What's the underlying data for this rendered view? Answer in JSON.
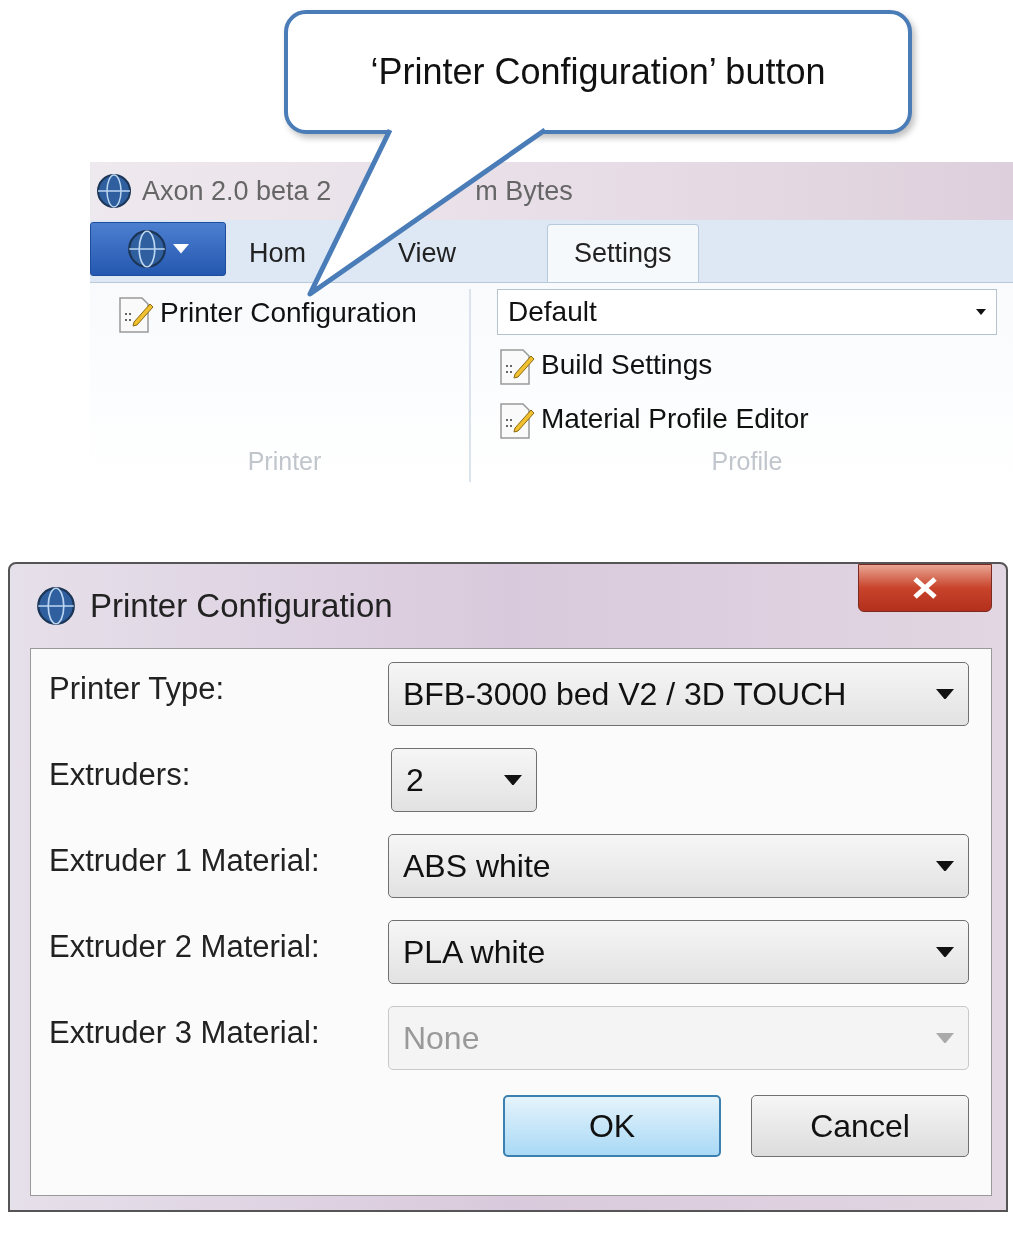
{
  "callout": {
    "text": "‘Printer Configuration’ button"
  },
  "app_window": {
    "title_parts": [
      "Axon 2.0 beta 2",
      "m Bytes"
    ],
    "tabs": [
      {
        "label": "Hom",
        "selected": false
      },
      {
        "label": "View",
        "selected": false
      },
      {
        "label": "Settings",
        "selected": true
      }
    ],
    "groups": [
      {
        "label": "Printer",
        "items": [
          {
            "kind": "button",
            "label": "Printer Configuration"
          }
        ]
      },
      {
        "label": "Profile",
        "items": [
          {
            "kind": "dropdown",
            "value": "Default"
          },
          {
            "kind": "button",
            "label": "Build Settings"
          },
          {
            "kind": "button",
            "label": "Material Profile Editor"
          }
        ]
      }
    ]
  },
  "dialog": {
    "title": "Printer Configuration",
    "fields": [
      {
        "label": "Printer Type:",
        "value": "BFB-3000 bed V2 / 3D TOUCH",
        "kind": "wide",
        "disabled": false
      },
      {
        "label": "Extruders:",
        "value": "2",
        "kind": "narrow",
        "disabled": false
      },
      {
        "label": "Extruder 1 Material:",
        "value": "ABS white",
        "kind": "wide",
        "disabled": false
      },
      {
        "label": "Extruder 2 Material:",
        "value": "PLA white",
        "kind": "wide",
        "disabled": false
      },
      {
        "label": "Extruder 3 Material:",
        "value": "None",
        "kind": "wide",
        "disabled": true
      }
    ],
    "buttons": [
      {
        "label": "OK",
        "default": true
      },
      {
        "label": "Cancel",
        "default": false
      }
    ]
  }
}
